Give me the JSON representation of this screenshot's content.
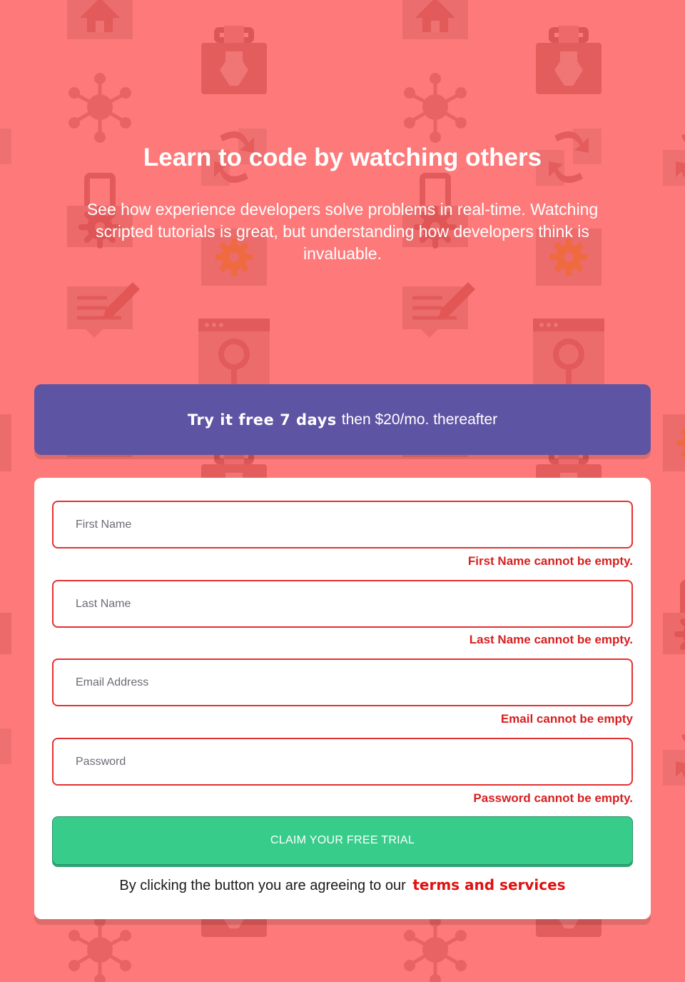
{
  "hero": {
    "title": "Learn to code by watching others",
    "description": "See how experience developers solve problems in real-time. Watching scripted tutorials is great, but understanding how developers think is invaluable."
  },
  "offer": {
    "bold_text": "Try it free 7 days",
    "rest_text": "then $20/mo. thereafter"
  },
  "form": {
    "fields": [
      {
        "placeholder": "First Name",
        "value": "",
        "error": "First Name cannot be empty."
      },
      {
        "placeholder": "Last Name",
        "value": "",
        "error": "Last Name cannot be empty."
      },
      {
        "placeholder": "Email Address",
        "value": "",
        "error": "Email cannot be empty"
      },
      {
        "placeholder": "Password",
        "value": "",
        "error": "Password cannot be empty."
      }
    ],
    "submit_label": "CLAIM YOUR FREE TRIAL",
    "terms_text": "By clicking the button you are agreeing to our",
    "terms_link": "terms and services"
  },
  "colors": {
    "background": "#fe7a7a",
    "banner": "#5e54a4",
    "button": "#38cc8b",
    "error": "#d71f1f",
    "card": "#ffffff"
  },
  "icons": [
    "home-icon",
    "toolbox-icon",
    "network-icon",
    "swap-icon",
    "mobile-icon",
    "gear-icon",
    "edit-icon",
    "browser-search-icon"
  ]
}
